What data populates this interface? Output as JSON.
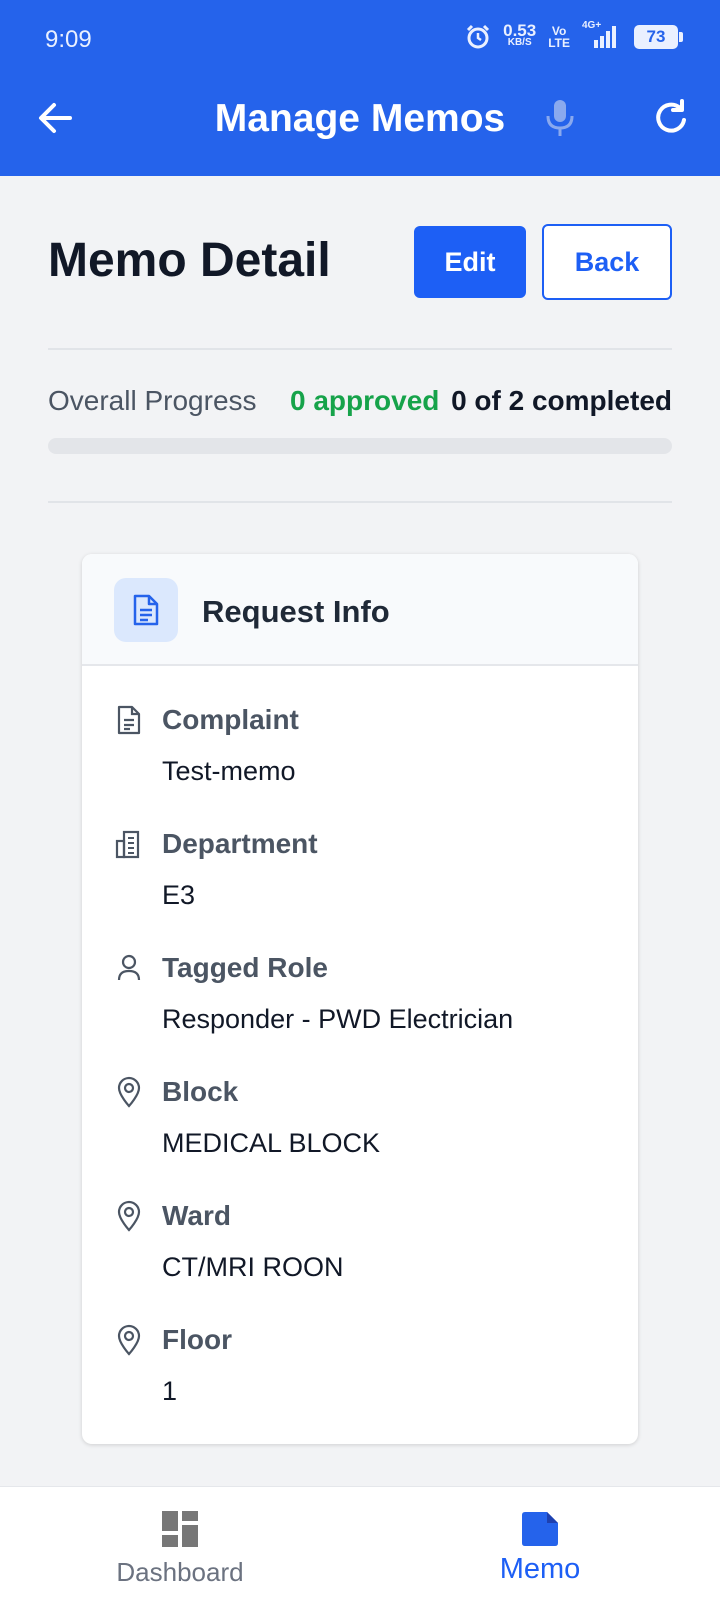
{
  "status_bar": {
    "time": "9:09",
    "net_speed": "0.53",
    "net_unit": "KB/S",
    "volte_top": "Vo",
    "volte_bottom": "LTE",
    "network": "4G+",
    "battery": "73"
  },
  "app_bar": {
    "title": "Manage Memos",
    "back_icon": "arrow-left-icon",
    "mic_icon": "microphone-icon",
    "refresh_icon": "refresh-icon"
  },
  "detail": {
    "title": "Memo Detail",
    "edit_label": "Edit",
    "back_label": "Back"
  },
  "progress": {
    "label": "Overall Progress",
    "approved": "0 approved",
    "completed": "0 of 2 completed",
    "fraction": 0
  },
  "card": {
    "title": "Request Info",
    "icon": "document-icon",
    "fields": [
      {
        "label": "Complaint",
        "value": "Test-memo",
        "icon": "document-icon"
      },
      {
        "label": "Department",
        "value": "E3",
        "icon": "building-icon"
      },
      {
        "label": "Tagged Role",
        "value": "Responder - PWD Electrician",
        "icon": "user-icon"
      },
      {
        "label": "Block",
        "value": "MEDICAL BLOCK",
        "icon": "map-pin-icon"
      },
      {
        "label": "Ward",
        "value": "CT/MRI ROON",
        "icon": "map-pin-icon"
      },
      {
        "label": "Floor",
        "value": "1",
        "icon": "map-pin-icon"
      }
    ]
  },
  "bottom_nav": {
    "items": [
      {
        "label": "Dashboard",
        "icon": "dashboard-icon",
        "active": false
      },
      {
        "label": "Memo",
        "icon": "memo-icon",
        "active": true
      }
    ]
  },
  "colors": {
    "primary": "#1d5ff5",
    "header": "#2563eb",
    "approved": "#16a34a"
  }
}
